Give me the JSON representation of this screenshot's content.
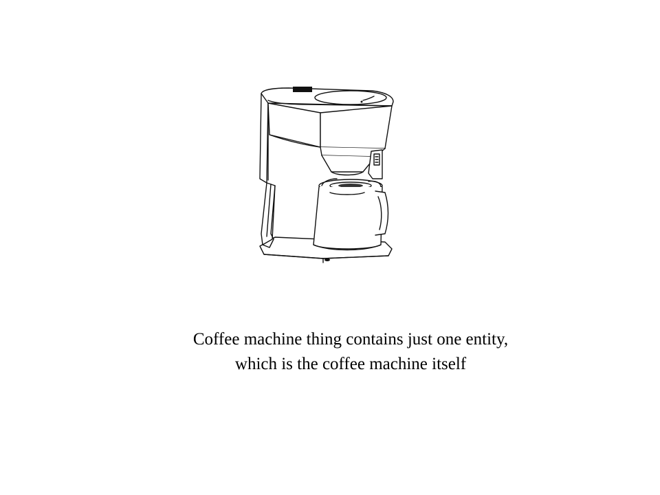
{
  "illustration": {
    "icon": "coffee-machine-icon",
    "stroke_color": "#111111",
    "fill_color": "#ffffff"
  },
  "caption": {
    "line1": "Coffee machine thing contains just one entity,",
    "line2": "which is the coffee machine itself",
    "color": "#000000"
  }
}
